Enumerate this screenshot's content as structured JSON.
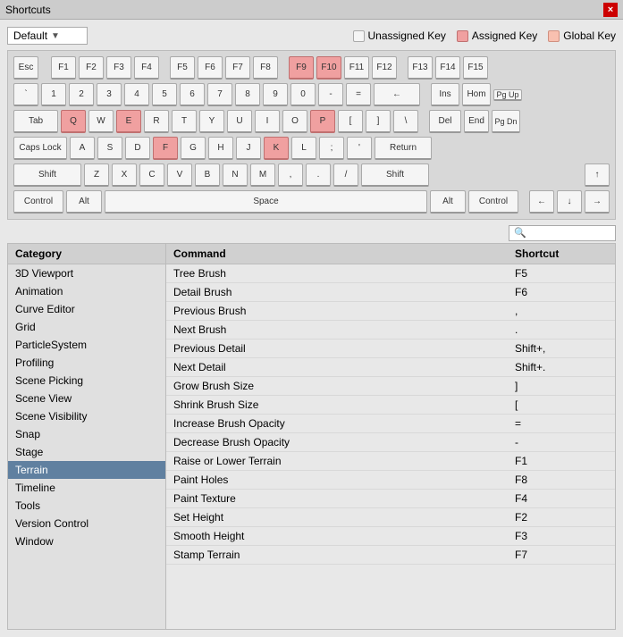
{
  "window": {
    "title": "Shortcuts",
    "close_label": "×"
  },
  "toolbar": {
    "dropdown_value": "Default",
    "dropdown_arrow": "▼",
    "legend": [
      {
        "id": "unassigned",
        "label": "Unassigned Key",
        "color": "#f5f5f5",
        "border": "#aaa"
      },
      {
        "id": "assigned",
        "label": "Assigned Key",
        "color": "#f0a0a0",
        "border": "#c07070"
      },
      {
        "id": "global",
        "label": "Global Key",
        "color": "#f8c0b0",
        "border": "#d09080"
      }
    ]
  },
  "keyboard": {
    "rows": [
      [
        "Esc",
        "F1",
        "F2",
        "F3",
        "F4",
        "F5",
        "F6",
        "F7",
        "F8",
        "F9",
        "F10",
        "F11",
        "F12",
        "F13",
        "F14",
        "F15"
      ],
      [
        "`",
        "1",
        "2",
        "3",
        "4",
        "5",
        "6",
        "7",
        "8",
        "9",
        "0",
        "-",
        "=",
        "←",
        "Ins",
        "Hom",
        "PgUp"
      ],
      [
        "Tab",
        "Q",
        "W",
        "E",
        "R",
        "T",
        "Y",
        "U",
        "I",
        "O",
        "P",
        "[",
        "]",
        "\\",
        "Del",
        "End",
        "PgDn"
      ],
      [
        "Caps Lock",
        "A",
        "S",
        "D",
        "F",
        "G",
        "H",
        "J",
        "K",
        "L",
        ";",
        "'",
        "Return"
      ],
      [
        "Shift",
        "Z",
        "X",
        "C",
        "V",
        "B",
        "N",
        "M",
        ",",
        ".",
        "/",
        "Shift",
        "↑"
      ],
      [
        "Control",
        "Alt",
        "Space",
        "Alt",
        "Control",
        "←",
        "↓",
        "→"
      ]
    ],
    "assigned_keys": [
      "F9",
      "F10",
      "Q",
      "E",
      "P",
      "F",
      "K"
    ],
    "global_keys": []
  },
  "search": {
    "placeholder": "🔍"
  },
  "category": {
    "header": "Category",
    "items": [
      "3D Viewport",
      "Animation",
      "Curve Editor",
      "Grid",
      "ParticleSystem",
      "Profiling",
      "Scene Picking",
      "Scene View",
      "Scene Visibility",
      "Snap",
      "Stage",
      "Terrain",
      "Timeline",
      "Tools",
      "Version Control",
      "Window"
    ],
    "selected": "Terrain"
  },
  "commands": {
    "col_command": "Command",
    "col_shortcut": "Shortcut",
    "items": [
      {
        "command": "Tree Brush",
        "shortcut": "F5"
      },
      {
        "command": "Detail Brush",
        "shortcut": "F6"
      },
      {
        "command": "Previous Brush",
        "shortcut": ","
      },
      {
        "command": "Next Brush",
        "shortcut": "."
      },
      {
        "command": "Previous Detail",
        "shortcut": "Shift+,"
      },
      {
        "command": "Next Detail",
        "shortcut": "Shift+."
      },
      {
        "command": "Grow Brush Size",
        "shortcut": "]"
      },
      {
        "command": "Shrink Brush Size",
        "shortcut": "["
      },
      {
        "command": "Increase Brush Opacity",
        "shortcut": "="
      },
      {
        "command": "Decrease Brush Opacity",
        "shortcut": "-"
      },
      {
        "command": "Raise or Lower Terrain",
        "shortcut": "F1"
      },
      {
        "command": "Paint Holes",
        "shortcut": "F8"
      },
      {
        "command": "Paint Texture",
        "shortcut": "F4"
      },
      {
        "command": "Set Height",
        "shortcut": "F2"
      },
      {
        "command": "Smooth Height",
        "shortcut": "F3"
      },
      {
        "command": "Stamp Terrain",
        "shortcut": "F7"
      }
    ]
  }
}
